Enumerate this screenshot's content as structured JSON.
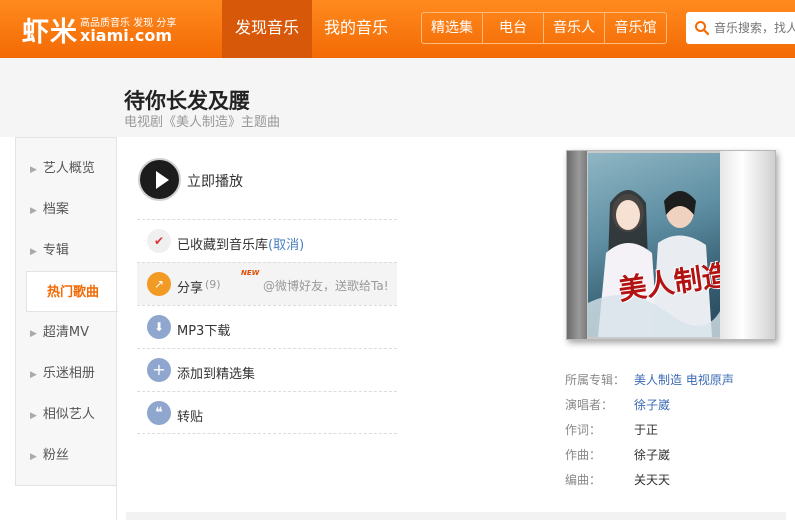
{
  "header": {
    "logo_cn": "虾米",
    "logo_tagline": "高品质音乐 发现 分享",
    "logo_domain": "xiami.com",
    "nav_main": [
      "发现音乐",
      "我的音乐"
    ],
    "subnav": [
      "精选集",
      "电台",
      "音乐人",
      "音乐馆"
    ],
    "search_placeholder": "音乐搜索，找人...",
    "brand_color": "#f36a05"
  },
  "song": {
    "title": "待你长发及腰",
    "subtitle": "电视剧《美人制造》主题曲"
  },
  "sidebar": {
    "items": [
      {
        "label": "艺人概览",
        "active": false
      },
      {
        "label": "档案",
        "active": false
      },
      {
        "label": "专辑",
        "active": false
      },
      {
        "label": "热门歌曲",
        "active": true
      },
      {
        "label": "超清MV",
        "active": false
      },
      {
        "label": "乐迷相册",
        "active": false
      },
      {
        "label": "相似艺人",
        "active": false
      },
      {
        "label": "粉丝",
        "active": false
      }
    ]
  },
  "actions": {
    "play_label": "立即播放",
    "collected_label": "已收藏到音乐库",
    "cancel_label": "(取消)",
    "share_label": "分享",
    "share_count": "(9)",
    "new_badge": "NEW",
    "share_hint": "@微博好友，送歌给Ta!",
    "download_label": "MP3下载",
    "add_to_collection_label": "添加到精选集",
    "repost_label": "转贴"
  },
  "album": {
    "cover_title": "美人制造",
    "info": [
      {
        "key": "所属专辑：",
        "value": "美人制造 电视原声",
        "link": true
      },
      {
        "key": "演唱者：",
        "value": "徐子崴",
        "link": true
      },
      {
        "key": "作词：",
        "value": "于正",
        "link": false
      },
      {
        "key": "作曲：",
        "value": "徐子崴",
        "link": false
      },
      {
        "key": "编曲：",
        "value": "关天天",
        "link": false
      }
    ]
  }
}
